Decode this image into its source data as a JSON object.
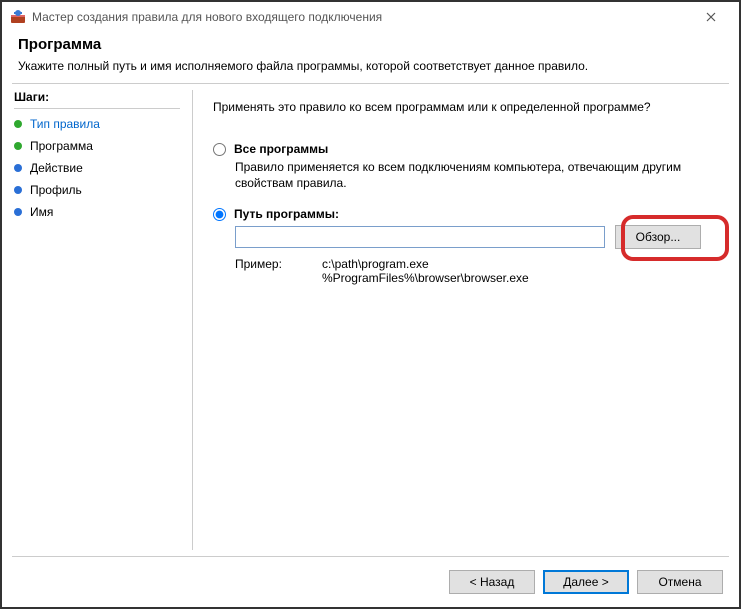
{
  "window": {
    "title": "Мастер создания правила для нового входящего подключения"
  },
  "header": {
    "title": "Программа",
    "subtitle": "Укажите полный путь и имя исполняемого файла программы, которой соответствует данное правило."
  },
  "sidebar": {
    "title": "Шаги:",
    "items": [
      {
        "label": "Тип правила",
        "bullet": "green",
        "active": true
      },
      {
        "label": "Программа",
        "bullet": "green",
        "active": false
      },
      {
        "label": "Действие",
        "bullet": "blue",
        "active": false
      },
      {
        "label": "Профиль",
        "bullet": "blue",
        "active": false
      },
      {
        "label": "Имя",
        "bullet": "blue",
        "active": false
      }
    ]
  },
  "content": {
    "question": "Применять это правило ко всем программам или к определенной программе?",
    "option_all": {
      "label": "Все программы",
      "desc": "Правило применяется ко всем подключениям компьютера, отвечающим другим свойствам правила."
    },
    "option_path": {
      "label": "Путь программы:",
      "value": "",
      "browse": "Обзор...",
      "example_label": "Пример:",
      "example_lines": "c:\\path\\program.exe\n%ProgramFiles%\\browser\\browser.exe"
    }
  },
  "footer": {
    "back": "< Назад",
    "next": "Далее >",
    "cancel": "Отмена"
  }
}
